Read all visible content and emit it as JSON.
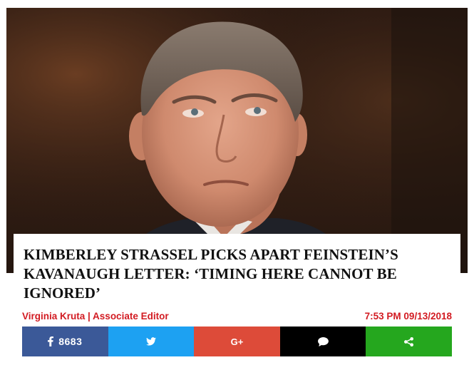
{
  "article": {
    "headline": "KIMBERLEY STRASSEL PICKS APART FEINSTEIN’S KAVANAUGH LETTER: ‘TIMING HERE CANNOT BE IGNORED’",
    "byline": "Virginia Kruta | Associate Editor",
    "timestamp": "7:53 PM 09/13/2018"
  },
  "share_bar": {
    "buttons": [
      {
        "name": "facebook",
        "icon": "facebook-icon",
        "count": "8683",
        "color": "#3b5998"
      },
      {
        "name": "twitter",
        "icon": "twitter-icon",
        "color": "#1da1f2"
      },
      {
        "name": "google-plus",
        "icon": "google-plus-icon",
        "glyph": "G+",
        "color": "#dd4b39"
      },
      {
        "name": "comments",
        "icon": "comment-icon",
        "color": "#000000"
      },
      {
        "name": "share",
        "icon": "share-icon",
        "color": "#25a71e"
      }
    ]
  },
  "theme": {
    "byline_color": "#d21b22",
    "headline_color": "#111111"
  }
}
